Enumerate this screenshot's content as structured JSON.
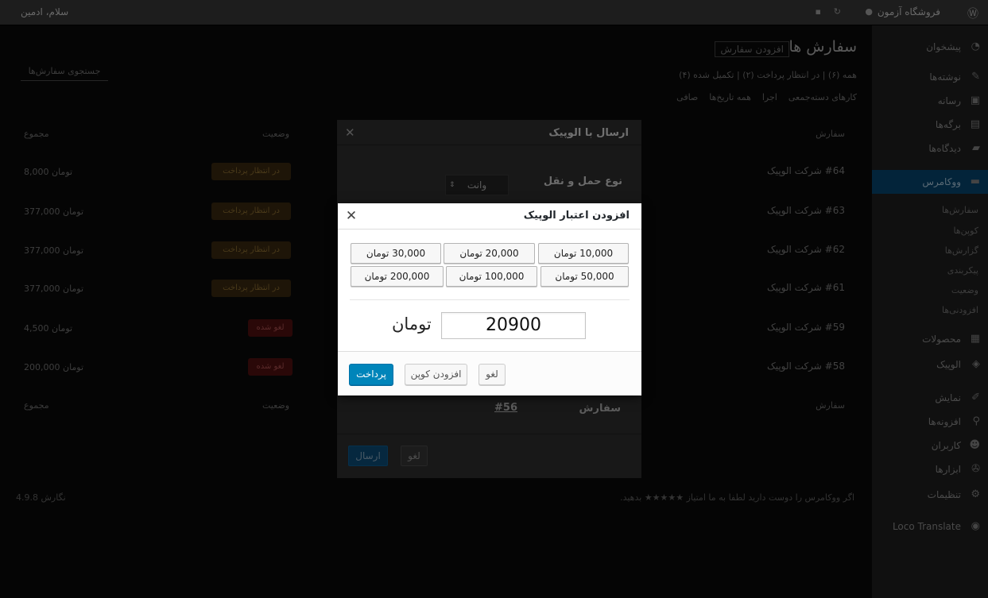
{
  "admin_bar": {
    "site_name": "فروشگاه آزمون",
    "greeting": "سلام، ادمین"
  },
  "sidebar": {
    "items": [
      {
        "label": "پیشخوان",
        "icon": "dashboard-icon"
      },
      {
        "label": "نوشته‌ها",
        "icon": "pin-icon"
      },
      {
        "label": "رسانه",
        "icon": "media-icon"
      },
      {
        "label": "برگه‌ها",
        "icon": "page-icon"
      },
      {
        "label": "دیدگاه‌ها",
        "icon": "comment-icon"
      },
      {
        "label": "ووکامرس",
        "icon": "woo-icon"
      },
      {
        "label": "محصولات",
        "icon": "product-icon"
      },
      {
        "label": "الوپیک",
        "icon": "delivery-icon"
      },
      {
        "label": "نمایش",
        "icon": "brush-icon"
      },
      {
        "label": "افزونه‌ها",
        "icon": "plugin-icon"
      },
      {
        "label": "کاربران",
        "icon": "user-icon"
      },
      {
        "label": "ابزارها",
        "icon": "tool-icon"
      },
      {
        "label": "تنظیمات",
        "icon": "settings-icon"
      },
      {
        "label": "Loco Translate",
        "icon": "translate-icon"
      }
    ],
    "subitems": [
      "سفارش‌ها",
      "کوپن‌ها",
      "گزارش‌ها",
      "پیکربندی",
      "وضعیت",
      "افزودنی‌ها"
    ]
  },
  "page": {
    "title": "سفارش ها",
    "add_new": "افزودن سفارش",
    "filters": "همه (۶) | در انتظار پرداخت (۲) | تکمیل شده (۴)",
    "bulk_actions": "کارهای دسته‌جمعی",
    "apply": "اجرا",
    "date_filter": "همه تاریخ‌ها",
    "filter_button": "صافی",
    "search_button": "جستجوی سفارش‌ها",
    "col_order": "سفارش",
    "col_status": "وضعیت",
    "col_total": "مجموع",
    "footer_left": "نگارش 4.9.8",
    "footer_right": "اگر ووکامرس را دوست دارید لطفا به ما امتیاز ★★★★★ بدهید."
  },
  "orders": [
    {
      "order": "#64 شرکت الوپیک",
      "status": "در انتظار پرداخت",
      "total": "8,000 تومان",
      "status_kind": "pending"
    },
    {
      "order": "#63 شرکت الوپیک",
      "status": "در انتظار پرداخت",
      "total": "377,000 تومان",
      "status_kind": "pending"
    },
    {
      "order": "#62 شرکت الوپیک",
      "status": "در انتظار پرداخت",
      "total": "377,000 تومان",
      "status_kind": "pending"
    },
    {
      "order": "#61 شرکت الوپیک",
      "status": "در انتظار پرداخت",
      "total": "377,000 تومان",
      "status_kind": "pending"
    },
    {
      "order": "#59 شرکت الوپیک",
      "status": "لغو شده",
      "total": "4,500 تومان",
      "status_kind": "cancelled"
    },
    {
      "order": "#58 شرکت الوپیک",
      "status": "لغو شده",
      "total": "200,000 تومان",
      "status_kind": "cancelled"
    }
  ],
  "send_modal": {
    "title": "ارسال با الوپیک",
    "transport_label": "نوع حمل و نقل",
    "transport_value": "وانت",
    "order_label": "سفارش",
    "order_link": "#56",
    "send_button": "ارسال",
    "cancel_button": "لغو"
  },
  "credit_modal": {
    "title": "افزودن اعتبار الوپیک",
    "amounts": [
      "10,000 تومان",
      "20,000 تومان",
      "30,000 تومان",
      "50,000 تومان",
      "100,000 تومان",
      "200,000 تومان"
    ],
    "amount_value": "20900",
    "currency": "تومان",
    "pay_button": "پرداخت",
    "coupon_button": "افزودن کوپن",
    "cancel_button": "لغو"
  }
}
